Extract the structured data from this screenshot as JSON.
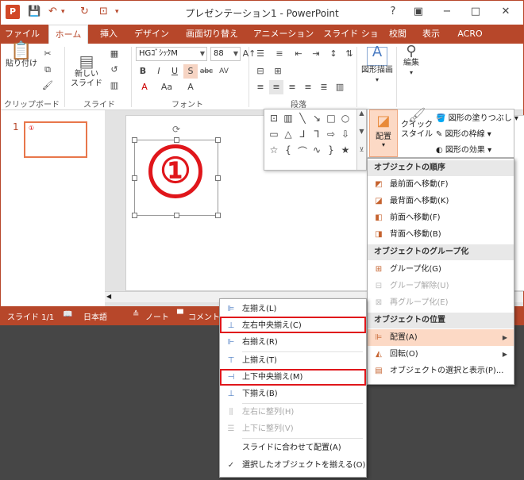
{
  "app": {
    "title": "プレゼンテーション1 - PowerPoint",
    "logo": "P"
  },
  "window_controls": {
    "help": "?",
    "restore": "▣",
    "minimize": "−",
    "maximize": "□",
    "close": "✕"
  },
  "tabs": [
    "ファイル",
    "ホーム",
    "挿入",
    "デザイン",
    "画面切り替え",
    "アニメーション",
    "スライド ショー",
    "校閲",
    "表示",
    "ACRO"
  ],
  "ribbon": {
    "paste_label": "貼り付け",
    "new_slide_label": "新しい\nスライド",
    "font_name": "HGｺﾞｼｯｸM",
    "font_size": "88",
    "shape_label": "図形描画",
    "edit_label": "編集",
    "groups": {
      "clipboard": "クリップボード",
      "slide": "スライド",
      "font": "フォント",
      "paragraph": "段落"
    }
  },
  "arrange_panel": {
    "arrange_label": "配置",
    "quick_style_label": "クイック\nスタイル",
    "shape_fill": "図形の塗りつぶし",
    "shape_outline": "図形の枠線",
    "shape_effects": "図形の効果"
  },
  "slide": {
    "thumbnail_number": "1",
    "content": "①",
    "thumb_content": "①"
  },
  "statusbar": {
    "slide_info": "スライド 1/1",
    "language": "日本語",
    "notes": "ノート",
    "comments": "コメント"
  },
  "arrange_menu": {
    "order_header": "オブジェクトの順序",
    "bring_to_front": "最前面へ移動(F)",
    "send_to_back": "最背面へ移動(K)",
    "bring_forward": "前面へ移動(F)",
    "send_backward": "背面へ移動(B)",
    "group_header": "オブジェクトのグループ化",
    "group": "グループ化(G)",
    "ungroup": "グループ解除(U)",
    "regroup": "再グループ化(E)",
    "position_header": "オブジェクトの位置",
    "align": "配置(A)",
    "rotate": "回転(O)",
    "selection_pane": "オブジェクトの選択と表示(P)..."
  },
  "align_menu": {
    "align_left": "左揃え(L)",
    "align_center": "左右中央揃え(C)",
    "align_right": "右揃え(R)",
    "align_top": "上揃え(T)",
    "align_middle": "上下中央揃え(M)",
    "align_bottom": "下揃え(B)",
    "distribute_h": "左右に整列(H)",
    "distribute_v": "上下に整列(V)",
    "align_to_slide": "スライドに合わせて配置(A)",
    "align_selected": "選択したオブジェクトを揃える(O)"
  },
  "colors": {
    "accent": "#b7472a",
    "highlight": "#fcd9c5",
    "red_marker": "#e0161b"
  }
}
